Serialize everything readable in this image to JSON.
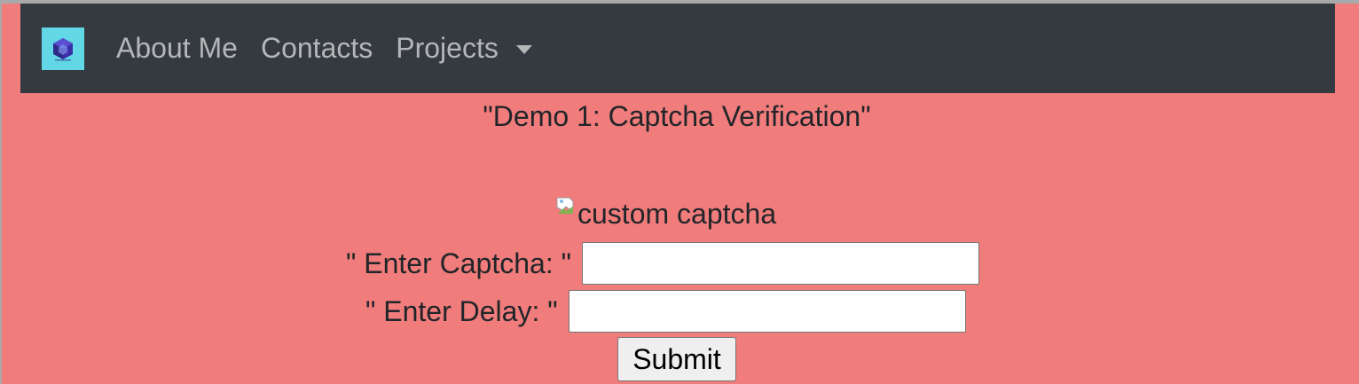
{
  "navbar": {
    "logo_icon": "cube-logo-icon",
    "links": [
      {
        "label": "About Me"
      },
      {
        "label": "Contacts"
      }
    ],
    "dropdown": {
      "label": "Projects",
      "icon": "caret-down-icon"
    }
  },
  "main": {
    "demo_title": "\"Demo 1: Captcha Verification\"",
    "captcha_image_alt": "custom captcha",
    "captcha_label": "\" Enter Captcha: \"",
    "captcha_value": "",
    "delay_label": "\" Enter Delay: \"",
    "delay_value": "",
    "submit_label": "Submit"
  },
  "colors": {
    "page_background": "#f07c7b",
    "navbar_background": "#343a40",
    "nav_link": "#b4b6b8",
    "logo_background": "#62d8e6"
  }
}
